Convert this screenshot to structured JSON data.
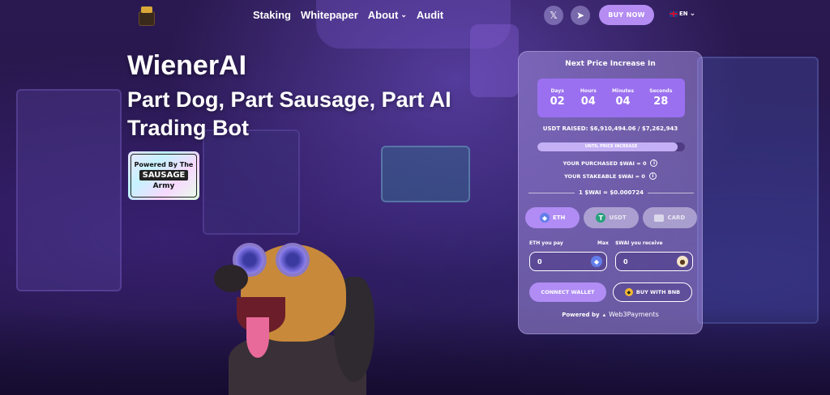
{
  "nav": {
    "items": [
      {
        "label": "Staking"
      },
      {
        "label": "Whitepaper"
      },
      {
        "label": "About"
      },
      {
        "label": "Audit"
      }
    ],
    "buy_now": "BUY NOW",
    "language": "EN",
    "social": [
      "x-icon",
      "telegram-icon"
    ]
  },
  "hero": {
    "title": "WienerAI",
    "subtitle": "Part Dog, Part Sausage, Part AI Trading Bot",
    "badge": {
      "line1": "Powered By The",
      "line2": "SAUSAGE",
      "line3": "Army"
    }
  },
  "presale": {
    "title": "Next Price Increase In",
    "countdown": [
      {
        "label": "Days",
        "value": "02"
      },
      {
        "label": "Hours",
        "value": "04"
      },
      {
        "label": "Minutes",
        "value": "04"
      },
      {
        "label": "Seconds",
        "value": "28"
      }
    ],
    "raised": "USDT RAISED: $6,910,494.06 / $7,262,943",
    "progress_fraction": 0.95,
    "progress_text": "UNTIL PRICE INCREASE",
    "purchased": "YOUR PURCHASED $WAI = 0",
    "stakeable": "YOUR STAKEABLE $WAI = 0",
    "rate": "1 $WAI = $0.000724",
    "pay_tabs": [
      {
        "label": "ETH",
        "active": true
      },
      {
        "label": "USDT",
        "active": false
      },
      {
        "label": "CARD",
        "active": false
      }
    ],
    "pay_label": "ETH you pay",
    "max_label": "Max",
    "receive_label": "$WAI you receive",
    "pay_value": "0",
    "receive_value": "0",
    "connect_label": "CONNECT WALLET",
    "bnb_label": "BUY WITH BNB",
    "powered_by": "Powered by",
    "powered_name": "Web3Payments"
  },
  "colors": {
    "accent": "#b08cf4",
    "countdown_bg": "#9a70f0"
  }
}
